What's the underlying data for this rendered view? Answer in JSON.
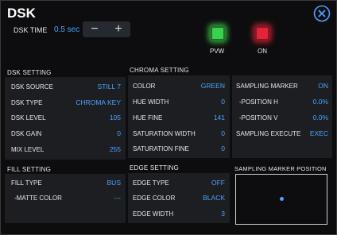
{
  "title": "DSK",
  "dsk_time": {
    "label": "DSK TIME",
    "value": "0.5 sec",
    "minus": "−",
    "plus": "+"
  },
  "lamps": {
    "pvw": "PVW",
    "on": "ON"
  },
  "dsk_setting": {
    "title": "DSK SETTING",
    "rows": [
      {
        "label": "DSK SOURCE",
        "value": "STILL 7"
      },
      {
        "label": "DSK TYPE",
        "value": "CHROMA KEY"
      },
      {
        "label": "DSK LEVEL",
        "value": "105"
      },
      {
        "label": "DSK GAIN",
        "value": "0"
      },
      {
        "label": "MIX LEVEL",
        "value": "255"
      }
    ]
  },
  "chroma_setting": {
    "title": "CHROMA SETTING",
    "left": [
      {
        "label": "COLOR",
        "value": "GREEN"
      },
      {
        "label": "HUE WIDTH",
        "value": "0"
      },
      {
        "label": "HUE FINE",
        "value": "141"
      },
      {
        "label": "SATURATION WIDTH",
        "value": "0"
      },
      {
        "label": "SATURATION FINE",
        "value": "0"
      }
    ],
    "right": [
      {
        "label": "SAMPLING MARKER",
        "value": "ON"
      },
      {
        "label": "-POSITION H",
        "value": "0.0%"
      },
      {
        "label": "-POSITION V",
        "value": "0.0%"
      },
      {
        "label": "SAMPLING EXECUTE",
        "value": "EXEC"
      }
    ]
  },
  "fill_setting": {
    "title": "FILL SETTING",
    "rows": [
      {
        "label": "FILL TYPE",
        "value": "BUS"
      },
      {
        "label": "-MATTE COLOR",
        "value": "---"
      }
    ]
  },
  "edge_setting": {
    "title": "EDGE SETTING",
    "rows": [
      {
        "label": "EDGE TYPE",
        "value": "OFF"
      },
      {
        "label": "EDGE COLOR",
        "value": "BLACK"
      },
      {
        "label": "EDGE WIDTH",
        "value": "3"
      }
    ]
  },
  "sampling_position": {
    "title": "SAMPLING MARKER POSITION"
  },
  "colors": {
    "accent": "#4aa3ff",
    "pvw": "#39d24a",
    "on": "#e4223a"
  }
}
